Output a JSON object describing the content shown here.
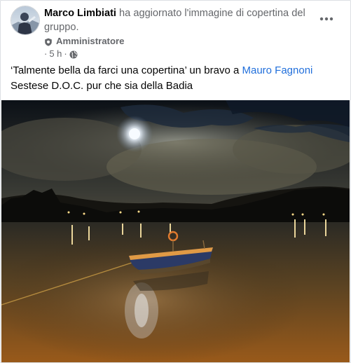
{
  "post": {
    "author": "Marco Limbiati",
    "action": "ha aggiornato l'immagine di copertina del gruppo.",
    "role": "Amministratore",
    "time": "5 h",
    "time_prefix": "·",
    "time_separator": "·",
    "caption_part1": "‘Talmente bella da farci una copertina’ un bravo a",
    "mention": "Mauro Fagnoni",
    "caption_part2": "Sestese D.O.C. pur che sia della Badia"
  },
  "icons": {
    "more": "more-options-icon",
    "role": "admin-shield-icon",
    "privacy": "globe-icon"
  },
  "colors": {
    "link": "#216fdb",
    "secondary_text": "#65676b",
    "primary_text": "#050505"
  }
}
